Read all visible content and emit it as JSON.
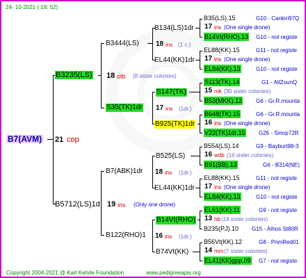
{
  "header": {
    "date": "24- 10-2021 ( 18: 52)"
  },
  "footer": {
    "copyright": "Copyright 2004-2021 @ Karl Kehrle Foundation",
    "site": "www.pedigreeapis.org"
  },
  "root": {
    "name": "B7(AVM)",
    "gen": "21",
    "type": "cop"
  },
  "gen1": [
    {
      "name": "B3235(LS)",
      "gen": "18",
      "type": "otb",
      "note": "(8 sister colonies)"
    },
    {
      "name": "B5712(LS)1d",
      "gen": "19",
      "type": "ins",
      "note": "(Only one drone)"
    }
  ],
  "gen2": [
    {
      "name": "B3444(LS)"
    },
    {
      "name": "S35(TK)1dr",
      "gen": "17",
      "type": "ins",
      "note": "(1dr.)"
    },
    {
      "name": "B7(ABK)1dr",
      "gen": "18",
      "type": "ins",
      "note": "(1dr.)"
    },
    {
      "name": "B122(RHO)1",
      "gen": "16",
      "type": "ins",
      "note": "(1dr.)"
    }
  ],
  "gen3": [
    {
      "name": "B134(LS)1dr",
      "gen": "18",
      "type": "ins",
      "note": "(1 c.)"
    },
    {
      "name": "EL44(KK)1dr",
      "gen": "17",
      "type": "ins",
      "note": "(1dr.)"
    },
    {
      "name": "S147(TK)"
    },
    {
      "name": "B925(TK)1dr",
      "gen": "16",
      "type": "ins",
      "note": "(One single drone)"
    },
    {
      "name": "B525(LS)"
    },
    {
      "name": "EL44(KK)1dr",
      "gen": "17",
      "type": "ins",
      "note": "(1dr.)"
    },
    {
      "name": "B14Vt(RHO)",
      "gen": "13",
      "type": "hb",
      "note": "(18 sister colonies)"
    },
    {
      "name": "B74Vt(KK)",
      "gen": "14",
      "type": "mm",
      "note": "(7 sister colonies)"
    }
  ],
  "gen3_extra": [
    {
      "gen": "18",
      "type": "ins",
      "note": "(1 c.)"
    },
    {
      "gen": "17",
      "type": "ins",
      "note": "(1dr.)"
    },
    {
      "gen": "15",
      "type": "mk",
      "note": "(30 sister colonies)"
    },
    {
      "gen": "16",
      "type": "ins",
      "note": "(One single drone)"
    },
    {
      "gen": "16",
      "type": "wdb",
      "note": "(16 sister colonies)"
    },
    {
      "gen": "17",
      "type": "ins",
      "note": "(1dr.)"
    },
    {
      "gen": "13",
      "type": "hb",
      "note": "(18 sister colonies)"
    },
    {
      "gen": "14",
      "type": "mm",
      "note": "(7 sister colonies)"
    }
  ],
  "gen4": [
    {
      "name": "B35(LS).15",
      "code": "G10 - Cankiri97Q"
    },
    {
      "name": "B14Vt(RHO).13",
      "code": "G10 - not registe"
    },
    {
      "name": "EL88(KK).15",
      "code": "G11 - not registe"
    },
    {
      "name": "EL84(KK).13",
      "code": "G10 - not registe"
    },
    {
      "name": "S113(TK).14",
      "code": "G1 - AltZounQ"
    },
    {
      "name": "B53(MKK).12",
      "code": "G6 - Gr.R.mounta"
    },
    {
      "name": "B648(TK).15",
      "code": "G6 - Gr.R.mounta"
    },
    {
      "name": "V22(TK)1dr.15",
      "code": "G26 - Sinop72R"
    },
    {
      "name": "B554(LS).14",
      "code": "G9 - Bayburt98-3"
    },
    {
      "name": "B91(BB).13",
      "code": "G6 - B314(NE)"
    },
    {
      "name": "EL88(KK).15",
      "code": "G11 - not registe"
    },
    {
      "name": "EL84(KK).13",
      "code": "G10 - not registe"
    },
    {
      "name": "EL61(KK).11",
      "code": "G9 - not registe"
    },
    {
      "name": "B235(PJ).10",
      "code": "G15 - Athos St80R"
    },
    {
      "name": "B56Vt(KK).12",
      "code": "G8 - PrimRed01"
    },
    {
      "name": "EL41(KK)gpp.09",
      "code": "G7 - not registe"
    }
  ],
  "gen4_mid": [
    {
      "gen": "17",
      "type": "ins",
      "note": "(One single drone)"
    },
    {
      "gen": "17",
      "type": "ins",
      "note": "(One single drone)"
    },
    {
      "gen": "15",
      "type": "mk",
      "note": "(30 sister colonies)"
    },
    {
      "gen": "16",
      "type": "ins",
      "note": "(One single drone)"
    },
    {
      "gen": "16",
      "type": "wdb",
      "note": "(16 sister colonies)"
    },
    {
      "gen": "17",
      "type": "ins",
      "note": "(One single drone)"
    },
    {
      "gen": "13",
      "type": "hb",
      "note": "(18 sister colonies)"
    },
    {
      "gen": "14",
      "type": "mm",
      "note": "(7 sister colonies)"
    }
  ]
}
